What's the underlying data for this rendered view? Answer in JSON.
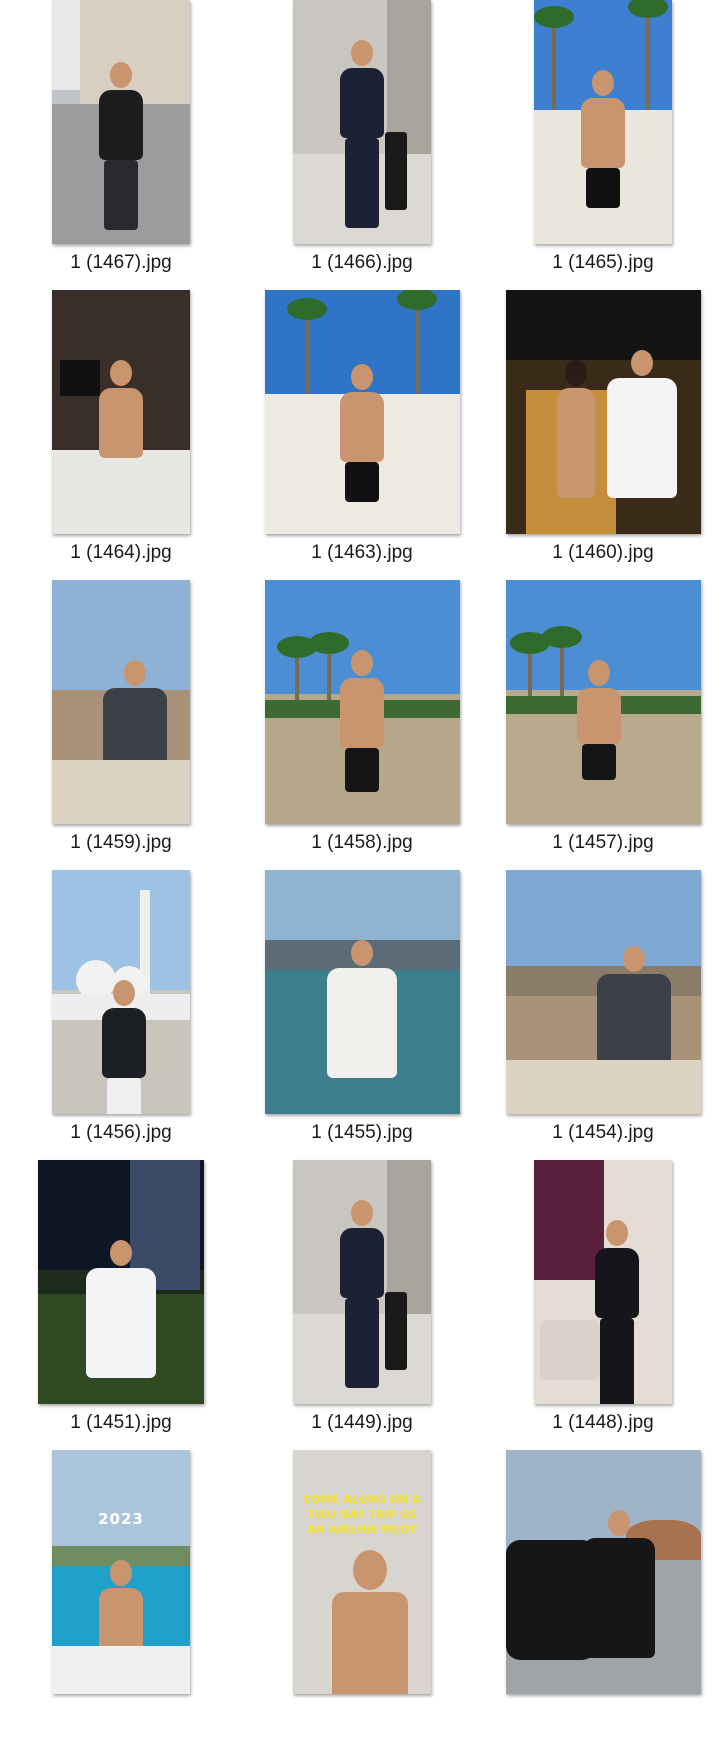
{
  "files": [
    {
      "name": "1 (1467).jpg",
      "scene": "city-street-icon"
    },
    {
      "name": "1 (1466).jpg",
      "scene": "hallway-suit-icon"
    },
    {
      "name": "1 (1465).jpg",
      "scene": "beach-palms-icon"
    },
    {
      "name": "1 (1464).jpg",
      "scene": "kitchen-icon"
    },
    {
      "name": "1 (1463).jpg",
      "scene": "beach-palms-icon"
    },
    {
      "name": "1 (1460).jpg",
      "scene": "night-couple-icon"
    },
    {
      "name": "1 (1459).jpg",
      "scene": "terrace-cafe-icon"
    },
    {
      "name": "1 (1458).jpg",
      "scene": "resort-beach-icon"
    },
    {
      "name": "1 (1457).jpg",
      "scene": "resort-beach-icon"
    },
    {
      "name": "1 (1456).jpg",
      "scene": "mosque-icon"
    },
    {
      "name": "1 (1455).jpg",
      "scene": "skyline-sunset-icon"
    },
    {
      "name": "1 (1454).jpg",
      "scene": "terrace-cafe-icon"
    },
    {
      "name": "1 (1451).jpg",
      "scene": "night-city-icon"
    },
    {
      "name": "1 (1449).jpg",
      "scene": "hallway-suit-icon"
    },
    {
      "name": "1 (1448).jpg",
      "scene": "pilot-room-icon"
    },
    {
      "name": "",
      "scene": "boat-sea-icon",
      "overlay": "2023"
    },
    {
      "name": "",
      "scene": "selfie-mirror-icon",
      "overlay": "COME ALONG ON A TWO DAY TRIP AS AN AIRLINE PILOT"
    },
    {
      "name": "",
      "scene": "car-desert-icon"
    }
  ]
}
